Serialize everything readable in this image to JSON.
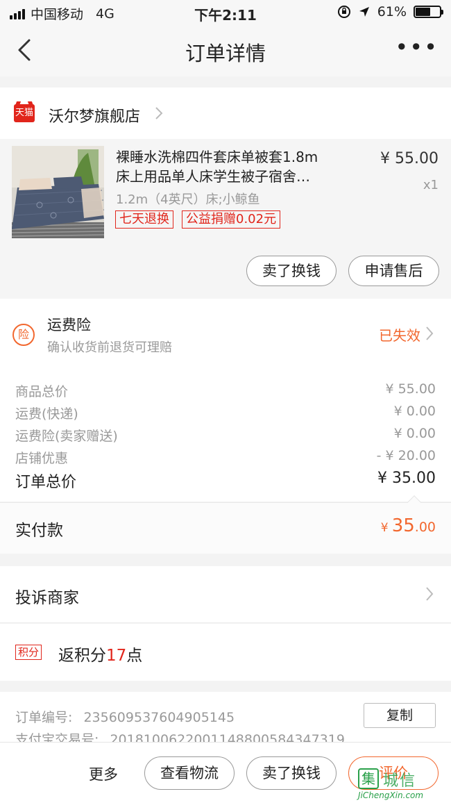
{
  "status_bar": {
    "carrier": "中国移动",
    "network": "4G",
    "time": "下午2:11",
    "battery_percent_label": "61%",
    "battery_level": 0.61
  },
  "nav": {
    "title": "订单详情",
    "more": "•••"
  },
  "shop": {
    "badge": "天猫",
    "name": "沃尔梦旗舰店"
  },
  "product": {
    "title_line1": "裸睡水洗棉四件套床单被套1.8m",
    "title_line2": "床上用品单人床学生被子宿舍…",
    "spec": "1.2m（4英尺）床;小鲸鱼",
    "tags": [
      "七天退换",
      "公益捐赠0.02元"
    ],
    "price": "¥ 55.00",
    "qty": "x1",
    "actions": {
      "sell": "卖了换钱",
      "after_sale": "申请售后"
    }
  },
  "insurance": {
    "icon": "险",
    "title": "运费险",
    "subtitle": "确认收货前退货可理赔",
    "status": "已失效"
  },
  "summary": {
    "rows": [
      {
        "label": "商品总价",
        "value": "¥ 55.00"
      },
      {
        "label": "运费(快递)",
        "value": "¥ 0.00"
      },
      {
        "label": "运费险(卖家赠送)",
        "value": "¥ 0.00"
      },
      {
        "label": "店铺优惠",
        "value": "- ¥ 20.00"
      }
    ],
    "total_label": "订单总价",
    "total_value": "¥ 35.00"
  },
  "paid": {
    "label": "实付款",
    "currency": "¥",
    "int": "35",
    "dec": ".00"
  },
  "complain": {
    "label": "投诉商家"
  },
  "points": {
    "badge": "积分",
    "prefix": "返积分",
    "count": "17",
    "suffix": "点"
  },
  "order_info": {
    "order_no_label": "订单编号:",
    "order_no": "235609537604905145",
    "alipay_label": "支付宝交易号:",
    "alipay_no": "2018100622001148800584347319",
    "copy": "复制"
  },
  "bottom_bar": {
    "more": "更多",
    "logistics": "查看物流",
    "sell": "卖了换钱",
    "review": "评价"
  },
  "watermark": {
    "icon": "集",
    "cn": "城信",
    "en": "JiChengXin.com"
  },
  "colors": {
    "accent": "#f2672e",
    "tmall_red": "#e1251b",
    "watermark_green": "#2aa04a"
  }
}
